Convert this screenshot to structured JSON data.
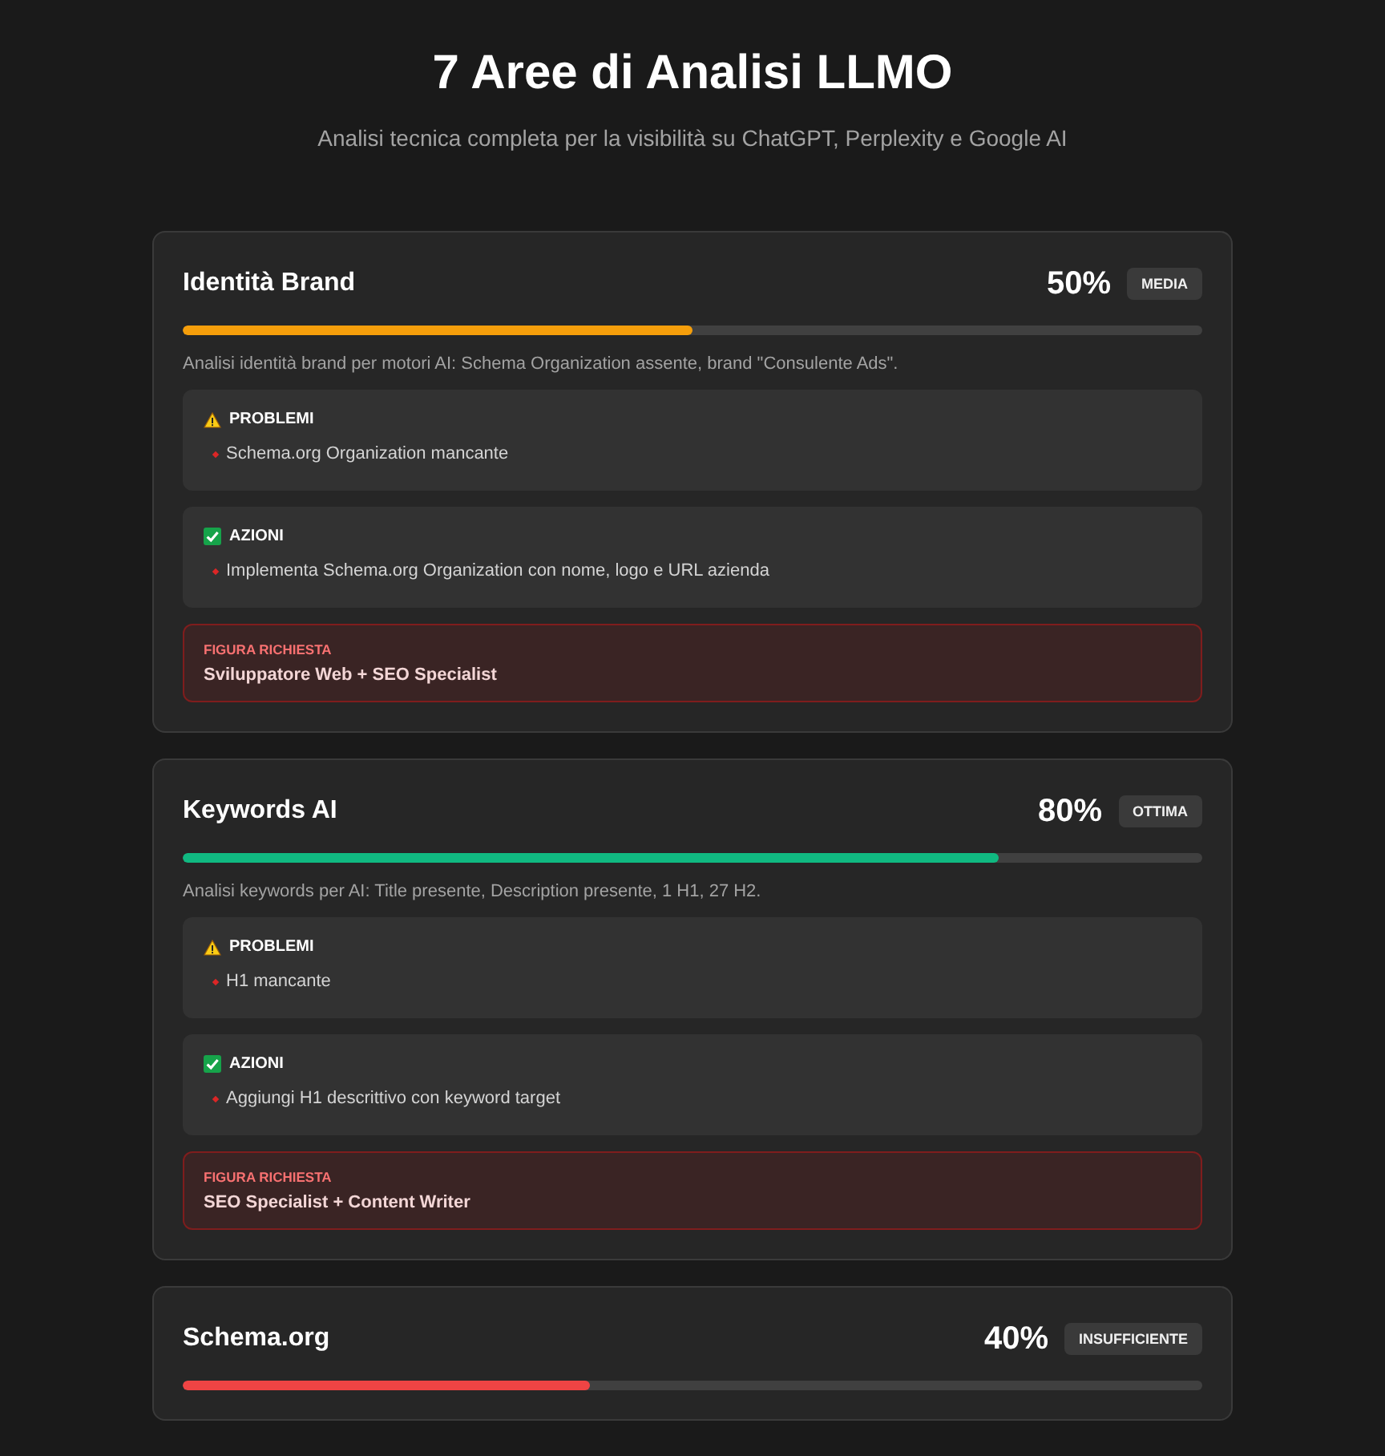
{
  "header": {
    "title": "7 Aree di Analisi LLMO",
    "subtitle": "Analisi tecnica completa per la visibilità su ChatGPT, Perplexity e Google AI"
  },
  "areas": [
    {
      "title": "Identità Brand",
      "score": "50%",
      "rating": "MEDIA",
      "level": 0.5,
      "color": "#f59e0b",
      "description": "Analisi identità brand per motori AI: Schema Organization assente, brand \"Consulente Ads\".",
      "sections": [
        {
          "kind": "problems",
          "heading": "PROBLEMI",
          "items": [
            "Schema.org Organization mancante"
          ]
        },
        {
          "kind": "actions",
          "heading": "AZIONI",
          "items": [
            "Implementa Schema.org Organization con nome, logo e URL azienda"
          ]
        }
      ],
      "figure": {
        "label": "FIGURA RICHIESTA",
        "value": "Sviluppatore Web + SEO Specialist"
      }
    },
    {
      "title": "Keywords AI",
      "score": "80%",
      "rating": "OTTIMA",
      "level": 0.8,
      "color": "#10b981",
      "description": "Analisi keywords per AI: Title presente, Description presente, 1 H1, 27 H2.",
      "sections": [
        {
          "kind": "problems",
          "heading": "PROBLEMI",
          "items": [
            "H1 mancante"
          ]
        },
        {
          "kind": "actions",
          "heading": "AZIONI",
          "items": [
            "Aggiungi H1 descrittivo con keyword target"
          ]
        }
      ],
      "figure": {
        "label": "FIGURA RICHIESTA",
        "value": "SEO Specialist + Content Writer"
      }
    },
    {
      "title": "Schema.org",
      "score": "40%",
      "rating": "INSUFFICIENTE",
      "level": 0.4,
      "color": "#ef4444"
    }
  ]
}
